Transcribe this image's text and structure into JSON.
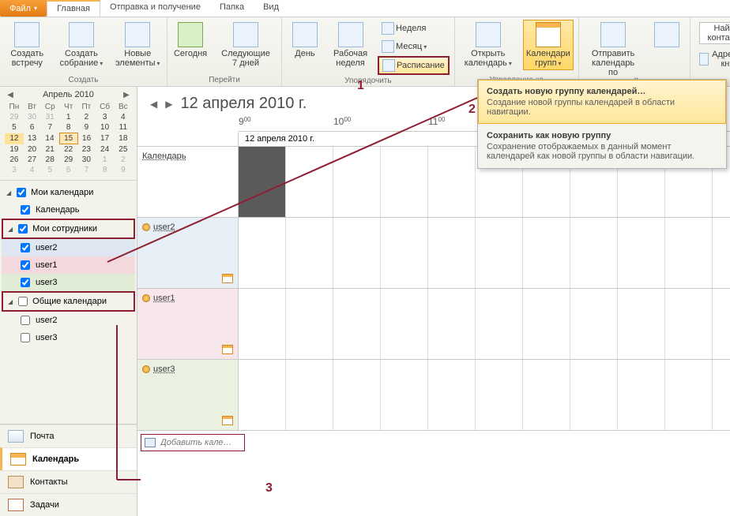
{
  "tabs": {
    "file": "Файл",
    "home": "Главная",
    "sendrecv": "Отправка и получение",
    "folder": "Папка",
    "view": "Вид"
  },
  "ribbon": {
    "create": {
      "label": "Создать",
      "meeting": "Создать встречу",
      "gathering": "Создать собрание",
      "items": "Новые элементы"
    },
    "goto": {
      "label": "Перейти",
      "today": "Сегодня",
      "next7": "Следующие 7 дней"
    },
    "arrange": {
      "label": "Упорядочить",
      "day": "День",
      "workweek": "Рабочая неделя",
      "week": "Неделя",
      "month": "Месяц",
      "schedule": "Расписание"
    },
    "manage": {
      "label": "Управление ка",
      "open": "Открыть календарь",
      "groups": "Календари групп"
    },
    "share": {
      "send": "Отправить календарь по электронной почте"
    },
    "find": {
      "findContact": "Найти контакт",
      "addressBook": "Адресная книга"
    }
  },
  "dropdown": {
    "create": {
      "title": "Создать новую группу календарей…",
      "desc": "Создание новой группы календарей в области навигации."
    },
    "save": {
      "title": "Сохранить как новую группу",
      "desc": "Сохранение отображаемых в данный момент календарей как новой группы в области навигации."
    }
  },
  "minical": {
    "month": "Апрель 2010",
    "dow": [
      "Пн",
      "Вт",
      "Ср",
      "Чт",
      "Пт",
      "Сб",
      "Вс"
    ],
    "weeks": [
      [
        {
          "d": "29",
          "dim": true
        },
        {
          "d": "30",
          "dim": true
        },
        {
          "d": "31",
          "dim": true
        },
        {
          "d": "1"
        },
        {
          "d": "2"
        },
        {
          "d": "3"
        },
        {
          "d": "4"
        }
      ],
      [
        {
          "d": "5"
        },
        {
          "d": "6"
        },
        {
          "d": "7"
        },
        {
          "d": "8"
        },
        {
          "d": "9"
        },
        {
          "d": "10"
        },
        {
          "d": "11"
        }
      ],
      [
        {
          "d": "12",
          "sel": true
        },
        {
          "d": "13"
        },
        {
          "d": "14"
        },
        {
          "d": "15",
          "today": true
        },
        {
          "d": "16"
        },
        {
          "d": "17"
        },
        {
          "d": "18"
        }
      ],
      [
        {
          "d": "19"
        },
        {
          "d": "20"
        },
        {
          "d": "21"
        },
        {
          "d": "22"
        },
        {
          "d": "23"
        },
        {
          "d": "24"
        },
        {
          "d": "25"
        }
      ],
      [
        {
          "d": "26"
        },
        {
          "d": "27"
        },
        {
          "d": "28"
        },
        {
          "d": "29"
        },
        {
          "d": "30"
        },
        {
          "d": "1",
          "dim": true
        },
        {
          "d": "2",
          "dim": true
        }
      ],
      [
        {
          "d": "3",
          "dim": true
        },
        {
          "d": "4",
          "dim": true
        },
        {
          "d": "5",
          "dim": true
        },
        {
          "d": "6",
          "dim": true
        },
        {
          "d": "7",
          "dim": true
        },
        {
          "d": "8",
          "dim": true
        },
        {
          "d": "9",
          "dim": true
        }
      ]
    ]
  },
  "tree": {
    "myCals": "Мои календари",
    "calendar": "Календарь",
    "coworkers": "Мои сотрудники",
    "u2": "user2",
    "u1": "user1",
    "u3": "user3",
    "shared": "Общие календари"
  },
  "modules": {
    "mail": "Почта",
    "calendar": "Календарь",
    "contacts": "Контакты",
    "tasks": "Задачи"
  },
  "schedule": {
    "title": "12 апреля 2010 г.",
    "date": "12 апреля 2010 г.",
    "hours": [
      "9",
      "10",
      "11"
    ],
    "min": "00",
    "rows": {
      "calendar": "Календарь",
      "u2": "user2",
      "u1": "user1",
      "u3": "user3"
    },
    "addPlaceholder": "Добавить кале…"
  },
  "markers": {
    "m1": "1",
    "m2": "2",
    "m3": "3"
  }
}
